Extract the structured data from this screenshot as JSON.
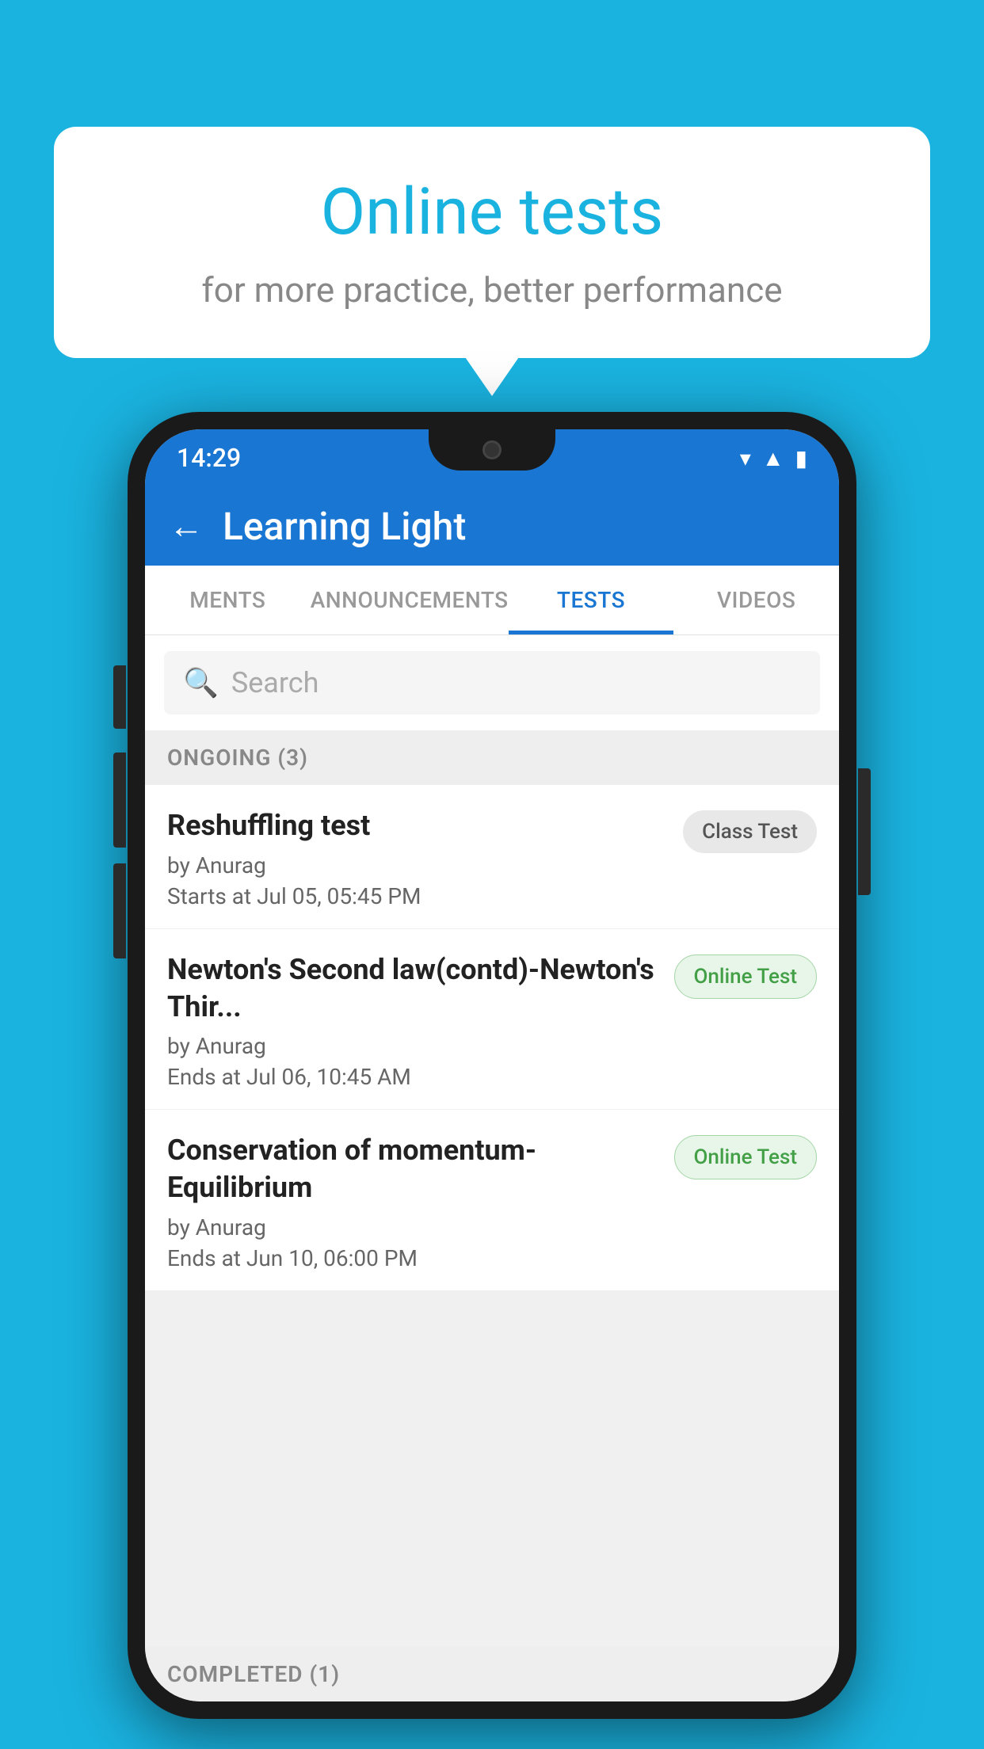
{
  "background_color": "#1ab3e0",
  "speech_bubble": {
    "title": "Online tests",
    "subtitle": "for more practice, better performance"
  },
  "phone": {
    "status_bar": {
      "time": "14:29",
      "icons": [
        "wifi",
        "signal",
        "battery"
      ]
    },
    "app_bar": {
      "title": "Learning Light",
      "back_label": "←"
    },
    "tabs": [
      {
        "label": "MENTS",
        "active": false
      },
      {
        "label": "ANNOUNCEMENTS",
        "active": false
      },
      {
        "label": "TESTS",
        "active": true
      },
      {
        "label": "VIDEOS",
        "active": false
      }
    ],
    "search": {
      "placeholder": "Search"
    },
    "ongoing_section": {
      "label": "ONGOING (3)",
      "tests": [
        {
          "name": "Reshuffling test",
          "author": "by Anurag",
          "time_label": "Starts at",
          "time": "Jul 05, 05:45 PM",
          "badge": "Class Test",
          "badge_type": "class"
        },
        {
          "name": "Newton's Second law(contd)-Newton's Thir...",
          "author": "by Anurag",
          "time_label": "Ends at",
          "time": "Jul 06, 10:45 AM",
          "badge": "Online Test",
          "badge_type": "online"
        },
        {
          "name": "Conservation of momentum-Equilibrium",
          "author": "by Anurag",
          "time_label": "Ends at",
          "time": "Jun 10, 06:00 PM",
          "badge": "Online Test",
          "badge_type": "online"
        }
      ]
    },
    "completed_section": {
      "label": "COMPLETED (1)"
    }
  }
}
